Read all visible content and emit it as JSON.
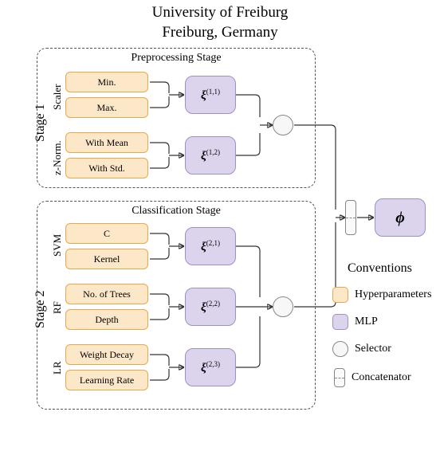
{
  "header": {
    "line1": "University of Freiburg",
    "line2": "Freiburg, Germany"
  },
  "stages": {
    "stage1": {
      "sideLabel": "Stage 1",
      "title": "Preprocessing Stage",
      "groups": [
        {
          "side": "Scaler",
          "hparams": [
            "Min.",
            "Max."
          ],
          "mlp_sup": "(1,1)"
        },
        {
          "side": "z-Norm.",
          "hparams": [
            "With Mean",
            "With Std."
          ],
          "mlp_sup": "(1,2)"
        }
      ]
    },
    "stage2": {
      "sideLabel": "Stage 2",
      "title": "Classification Stage",
      "groups": [
        {
          "side": "SVM",
          "hparams": [
            "C",
            "Kernel"
          ],
          "mlp_sup": "(2,1)"
        },
        {
          "side": "RF",
          "hparams": [
            "No. of Trees",
            "Depth"
          ],
          "mlp_sup": "(2,2)"
        },
        {
          "side": "LR",
          "hparams": [
            "Weight Decay",
            "Learning Rate"
          ],
          "mlp_sup": "(2,3)"
        }
      ]
    }
  },
  "phi_label": "ϕ",
  "xi_label": "ξ",
  "conventions": {
    "title": "Conventions",
    "items": [
      {
        "kind": "hparam",
        "label": "Hyperparameters"
      },
      {
        "kind": "mlp",
        "label": "MLP"
      },
      {
        "kind": "selector",
        "label": "Selector"
      },
      {
        "kind": "concat",
        "label": "Concatenator"
      }
    ]
  }
}
